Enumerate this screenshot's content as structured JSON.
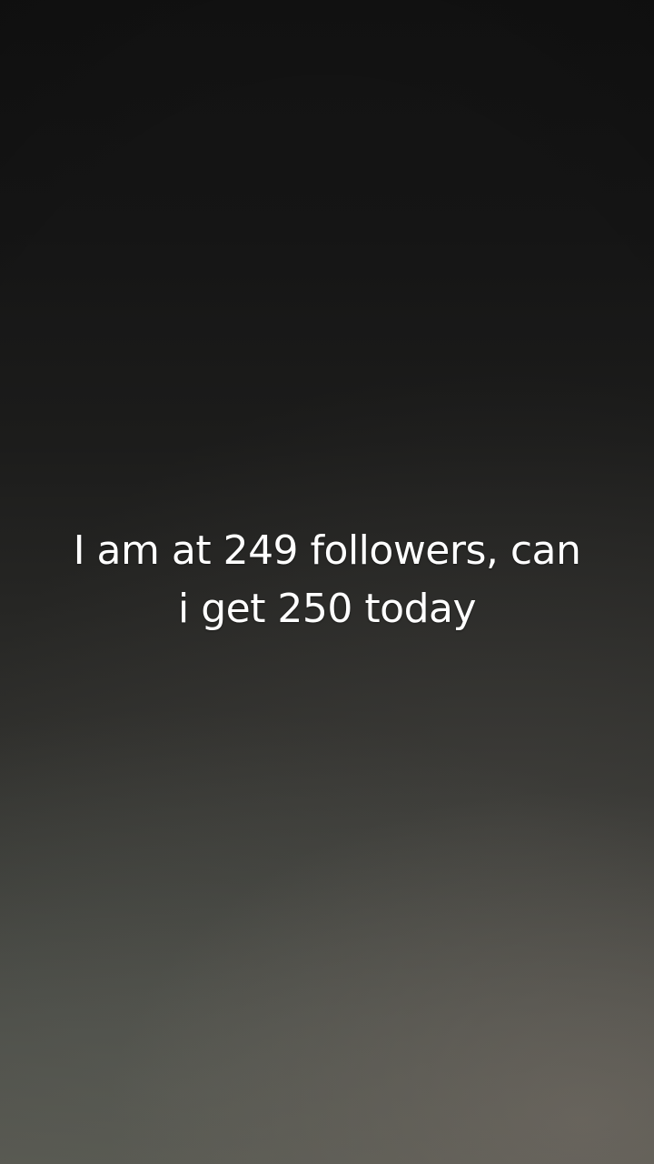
{
  "caption": {
    "line1": "I am at 249 followers, can",
    "line2": "i get 250 today"
  }
}
